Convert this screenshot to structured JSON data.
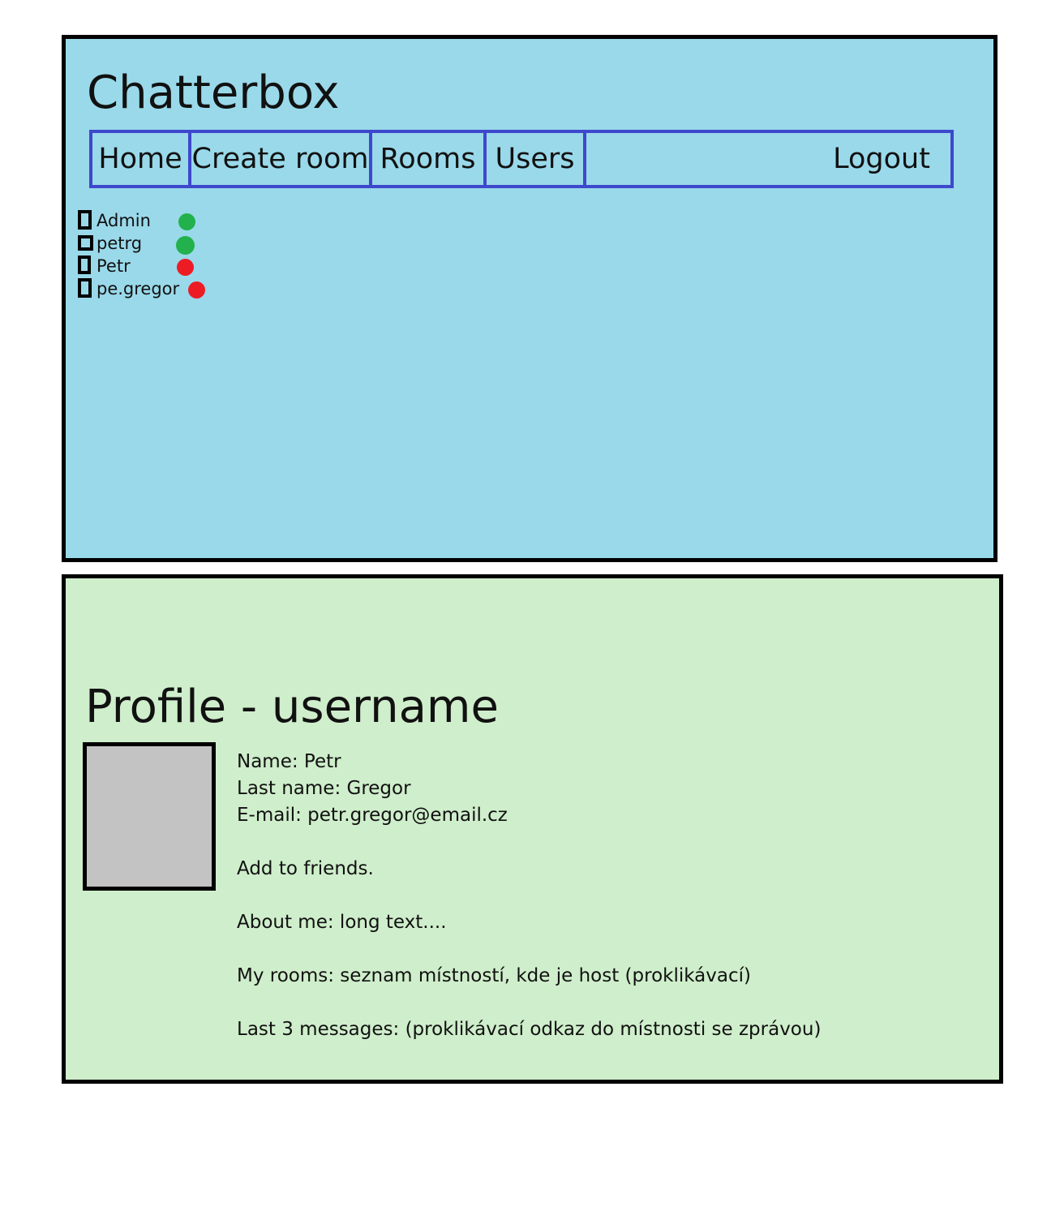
{
  "header": {
    "app_title": "Chatterbox",
    "nav": {
      "home": "Home",
      "create_room": "Create room",
      "rooms": "Rooms",
      "users": "Users",
      "logout": "Logout"
    },
    "users": [
      {
        "name": "Admin",
        "status": "online"
      },
      {
        "name": "petrg",
        "status": "online"
      },
      {
        "name": "Petr",
        "status": "offline"
      },
      {
        "name": "pe.gregor",
        "status": "offline"
      }
    ]
  },
  "profile": {
    "title": "Profile - username",
    "name_line": "Name: Petr",
    "last_name_line": "Last name: Gregor",
    "email_line": "E-mail: petr.gregor@email.cz",
    "add_friends": "Add to friends.",
    "about_me": "About me: long text....",
    "my_rooms": "My rooms: seznam místností, kde je host (proklikávací)",
    "last_messages": "Last 3 messages: (proklikávací odkaz do místnosti se zprávou)"
  },
  "colors": {
    "header_bg": "#99d9ea",
    "nav_border": "#3f48cc",
    "profile_bg": "#cfeecb",
    "avatar_bg": "#c3c3c3",
    "online": "#22b14c",
    "offline": "#ed1c24"
  }
}
